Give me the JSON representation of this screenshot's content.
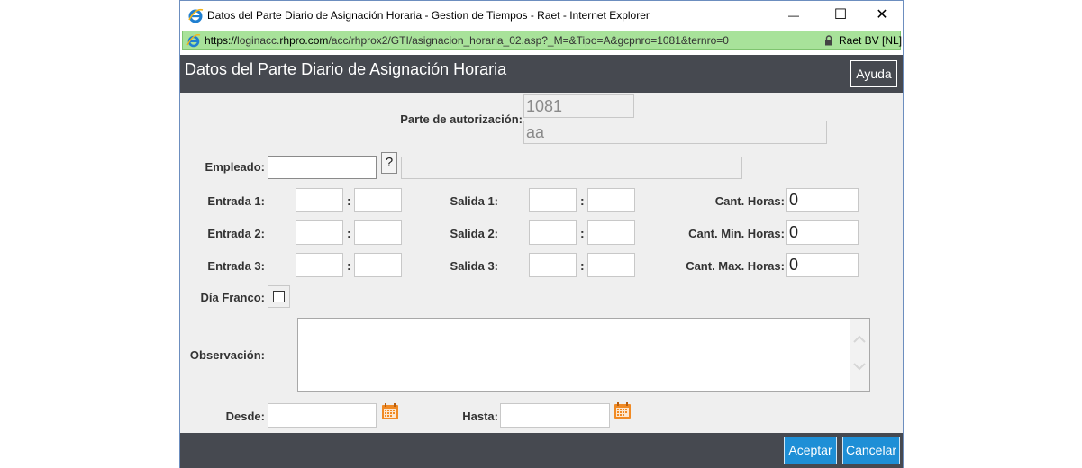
{
  "window": {
    "title": "Datos del Parte Diario de Asignación Horaria - Gestion de Tiempos - Raet - Internet Explorer",
    "minimize_label": "—",
    "maximize_label": "☐",
    "close_label": "✕"
  },
  "address_bar": {
    "url_scheme": "https://",
    "url_pre": "loginacc.",
    "url_domain": "rhpro.com",
    "url_path": "/acc/rhprox2/GTI/asignacion_horaria_02.asp?_M=&Tipo=A&gcpnro=1081&ternro=0",
    "site_identity": "Raet BV [NL]"
  },
  "header": {
    "title": "Datos del Parte Diario de Asignación Horaria",
    "help_button": "Ayuda"
  },
  "form": {
    "authorization": {
      "label": "Parte de autorización:",
      "number": "1081",
      "description": "aa"
    },
    "employee": {
      "label": "Empleado:",
      "value": "",
      "lookup_button": "?",
      "name": ""
    },
    "rows": [
      {
        "entry_label": "Entrada 1:",
        "exit_label": "Salida 1:",
        "hours_label": "Cant. Horas:",
        "hours_value": "0"
      },
      {
        "entry_label": "Entrada 2:",
        "exit_label": "Salida 2:",
        "hours_label": "Cant. Min. Horas:",
        "hours_value": "0"
      },
      {
        "entry_label": "Entrada 3:",
        "exit_label": "Salida 3:",
        "hours_label": "Cant. Max. Horas:",
        "hours_value": "0"
      }
    ],
    "time_separator": ":",
    "day_off": {
      "label": "Día Franco:",
      "checked": false
    },
    "observation": {
      "label": "Observación:",
      "value": ""
    },
    "from": {
      "label": "Desde:",
      "value": ""
    },
    "to": {
      "label": "Hasta:",
      "value": ""
    }
  },
  "footer": {
    "accept_button": "Aceptar",
    "cancel_button": "Cancelar"
  },
  "colors": {
    "header_bg": "#464950",
    "content_bg": "#efefef",
    "button_blue": "#1e8fd6",
    "address_green": "#a8e29a",
    "calendar_orange": "#f08a24"
  },
  "icons": {
    "browser": "ie-icon",
    "lock": "lock-icon",
    "calendar": "calendar-icon",
    "scroll_up": "chevron-up-icon",
    "scroll_down": "chevron-down-icon"
  }
}
